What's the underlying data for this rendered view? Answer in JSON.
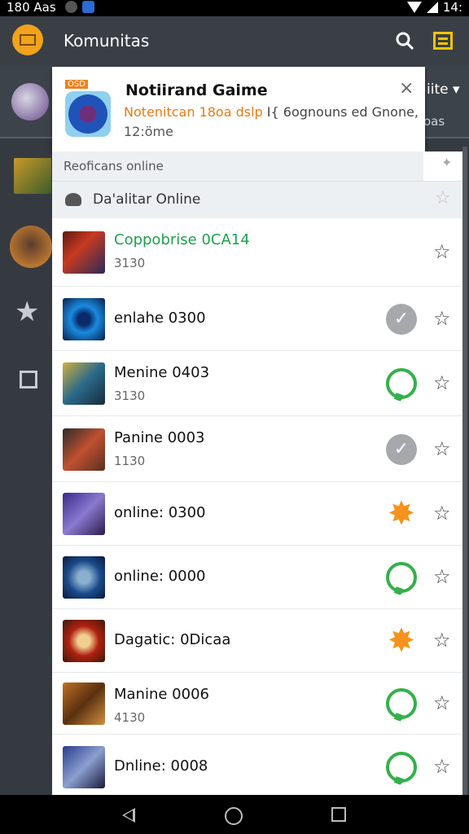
{
  "status_bar": {
    "time": "180 Aas",
    "right_text": "14:"
  },
  "app_bar": {
    "title": "Komunitas"
  },
  "sidebar": {
    "right_label_1": "iite ▾",
    "right_label_2": "oas"
  },
  "notification": {
    "badge": "OSD",
    "title": "Notiirand Gaime",
    "desc_highlight": "Notenitcan 18oa dslp",
    "desc_rest": " I{ 6ognouns ed Gnone,",
    "sub": "12:öme",
    "close": "×"
  },
  "list": {
    "section_header": "Reoficans online",
    "filter_label": "Da'alitar Online",
    "rows": [
      {
        "name": "Coppobrise 0CA14",
        "count": "3130",
        "name_green": true,
        "status": "none"
      },
      {
        "name": "enlahe 0300",
        "count": "",
        "status": "check"
      },
      {
        "name": "Menine 0403",
        "count": "3130",
        "status": "chat"
      },
      {
        "name": "Panine 0003",
        "count": "1130",
        "status": "check"
      },
      {
        "name": "online: 0300",
        "count": "",
        "status": "burst"
      },
      {
        "name": "online: 0000",
        "count": "",
        "status": "chat"
      },
      {
        "name": "Dagatic: 0Dicaa",
        "count": "",
        "status": "burst"
      },
      {
        "name": "Manine 0006",
        "count": "4130",
        "status": "chat"
      },
      {
        "name": "Dnline: 0008",
        "count": "",
        "status": "chat"
      }
    ]
  },
  "colors": {
    "accent_green": "#1aa34a",
    "accent_orange": "#f5931c",
    "app_bar": "#3a3f46"
  }
}
